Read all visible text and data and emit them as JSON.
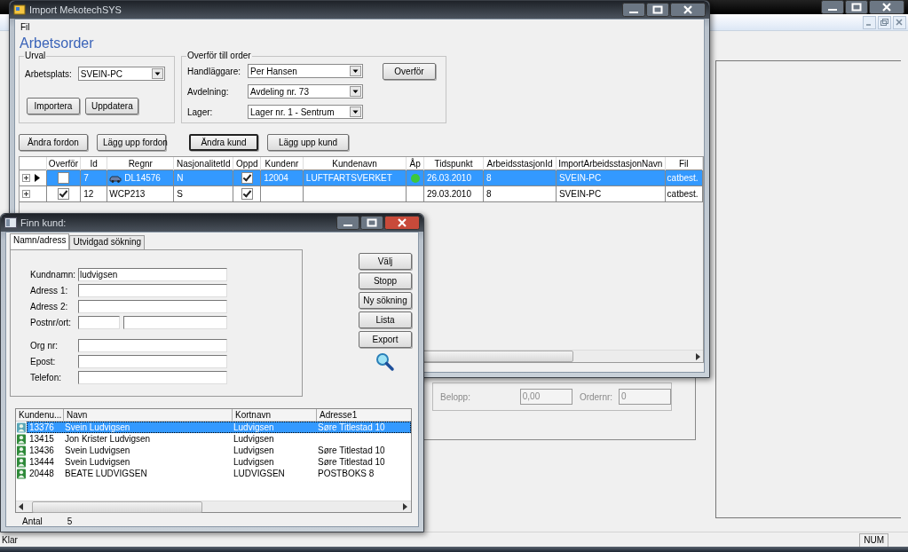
{
  "background_app": {
    "fields": [
      {
        "label": "Belopp:",
        "value": "0,00",
        "disabled": true
      },
      {
        "label": "Ordernr:",
        "value": "0",
        "disabled": true
      }
    ],
    "status_bar": {
      "text": "Klar",
      "indicator": "NUM"
    }
  },
  "import_window": {
    "title": "Import MekotechSYS",
    "menu": [
      "Fil"
    ],
    "heading": "Arbetsorder",
    "urval": {
      "legend": "Urval",
      "label": "Arbetsplats:",
      "value": "SVEIN-PC",
      "buttons": [
        "Importera",
        "Uppdatera"
      ]
    },
    "overfor": {
      "legend": "Overför till order",
      "fields": [
        {
          "label": "Handläggare:",
          "value": "Per Hansen"
        },
        {
          "label": "Avdelning:",
          "value": "Avdeling nr.   73"
        },
        {
          "label": "Lager:",
          "value": "Lager nr. 1 - Sentrum"
        }
      ],
      "button": "Overför"
    },
    "action_buttons": [
      {
        "label": "Ändra fordon",
        "default": false
      },
      {
        "label": "Lägg upp fordon",
        "default": false
      },
      {
        "label": "Ändra kund",
        "default": true
      },
      {
        "label": "Lägg upp kund",
        "default": false
      }
    ],
    "grid": {
      "columns": [
        "Overför",
        "Id",
        "Regnr",
        "NasjonalitetId",
        "Oppd",
        "Kundenr",
        "Kundenavn",
        "Åp",
        "Tidspunkt",
        "ArbeidsstasjonId",
        "ImportArbeidsstasjonNavn",
        "Fil"
      ],
      "rows": [
        {
          "selected": true,
          "expanded": false,
          "overfor": false,
          "id": "7",
          "regnr_icon": true,
          "regnr": "DL14576",
          "nasjonalitet": "N",
          "oppd": true,
          "kundenr": "12004",
          "kundenavn": "LUFTFARTSVERKET",
          "color": "#3cc83c",
          "tidspunkt": "26.03.2010",
          "arbeidsstasjon": "8",
          "import_navn": "SVEIN-PC",
          "fil": "catbest."
        },
        {
          "selected": false,
          "expanded": false,
          "overfor": true,
          "id": "12",
          "regnr_icon": false,
          "regnr": "WCP213",
          "nasjonalitet": "S",
          "oppd": true,
          "tidspunkt": "29.03.2010",
          "arbeidsstasjon": "8",
          "import_navn": "SVEIN-PC",
          "fil": "catbest."
        }
      ]
    }
  },
  "finn_kund": {
    "title": "Finn kund:",
    "tabs": [
      {
        "label": "Namn/adress",
        "selected": true
      },
      {
        "label": "Utvidgad sökning",
        "selected": false
      }
    ],
    "address_fields": [
      {
        "label": "Kundnamn:",
        "kind": "single",
        "value": "ludvigsen"
      },
      {
        "label": "Adress 1:",
        "kind": "single"
      },
      {
        "label": "Adress 2:",
        "kind": "single"
      },
      {
        "label": "Postnr/ort:",
        "kind": "split"
      }
    ],
    "contact_fields": [
      {
        "label": "Org nr:",
        "kind": "single"
      },
      {
        "label": "Epost:",
        "kind": "single"
      },
      {
        "label": "Telefon:",
        "kind": "single"
      }
    ],
    "buttons": [
      "Välj",
      "Stopp",
      "Ny sökning",
      "Lista",
      "Export"
    ],
    "results": {
      "columns": [
        "Kundenu...",
        "Navn",
        "Kortnavn",
        "Adresse1"
      ],
      "rows": [
        {
          "selected": true,
          "cells": [
            "13376",
            "Svein Ludvigsen",
            "Ludvigsen",
            "Søre Titlestad 10"
          ]
        },
        {
          "selected": false,
          "cells": [
            "13415",
            "Jon Krister Ludvigsen",
            "Ludvigsen",
            ""
          ]
        },
        {
          "selected": false,
          "cells": [
            "13436",
            "Svein Ludvigsen",
            "Ludvigsen",
            "Søre Titlestad 10"
          ]
        },
        {
          "selected": false,
          "cells": [
            "13444",
            "Svein Ludvigsen",
            "Ludvigsen",
            "Søre Titlestad 10"
          ]
        },
        {
          "selected": false,
          "cells": [
            "20448",
            "BEATE LUDVIGSEN",
            "LUDVIGSEN",
            "POSTBOKS 8"
          ]
        }
      ]
    },
    "count_label": "Antal",
    "count": "5"
  }
}
